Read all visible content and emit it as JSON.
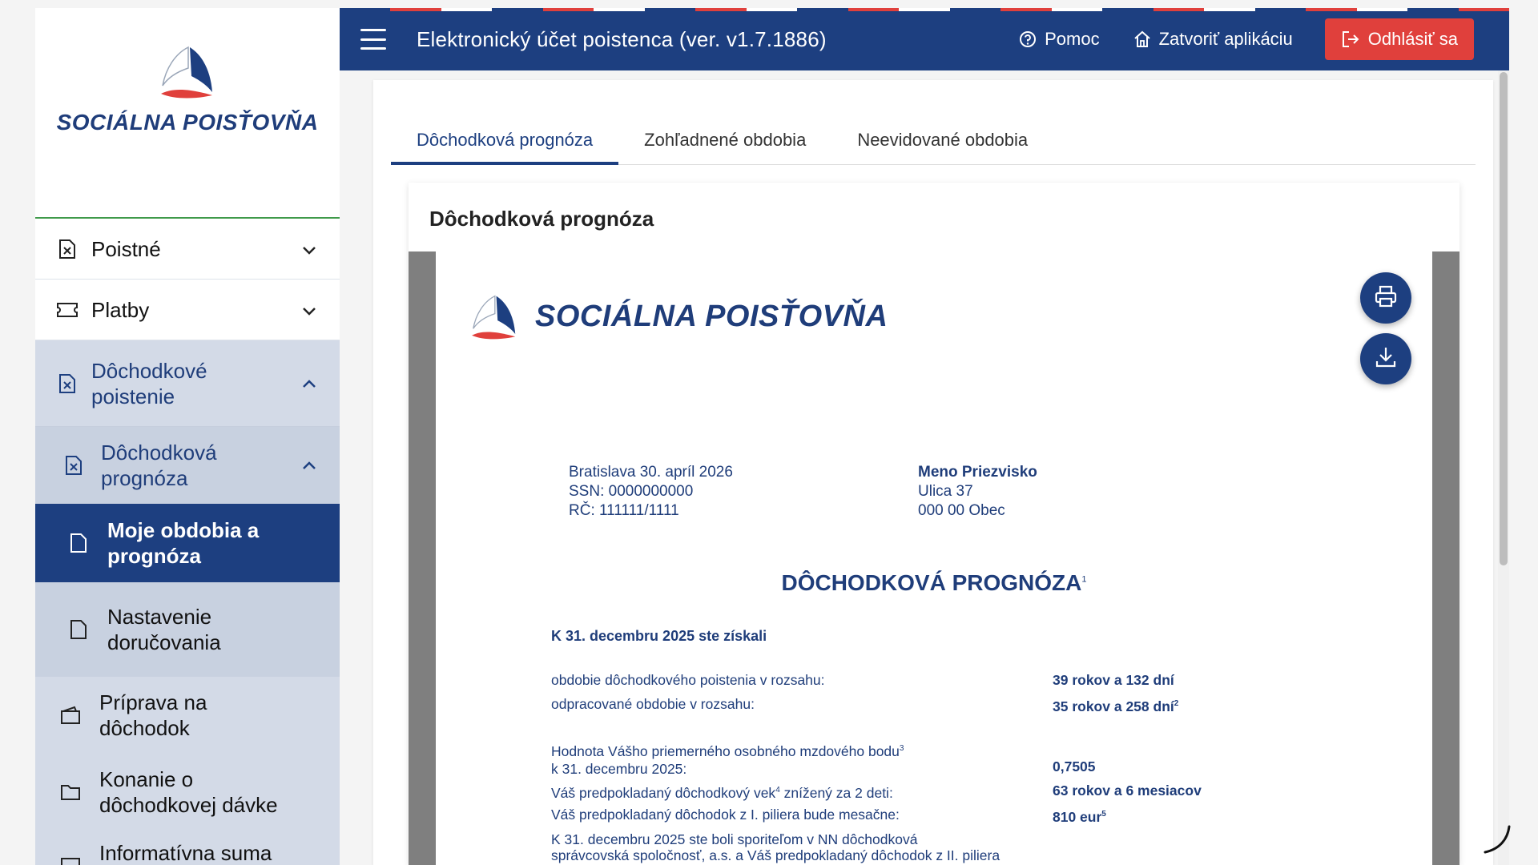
{
  "header": {
    "app_title": "Elektronický účet poistenca  (ver. v1.7.1886)",
    "help": "Pomoc",
    "close_app": "Zatvoriť aplikáciu",
    "logout": "Odhlásiť sa"
  },
  "sidebar": {
    "logo_text": "SOCIÁLNA POISŤOVŇA",
    "items": [
      {
        "label": "Poistné"
      },
      {
        "label": "Platby"
      },
      {
        "label": "Dôchodkové poistenie"
      },
      {
        "label": "Dôchodková prognóza"
      },
      {
        "label": "Moje obdobia a prognóza"
      },
      {
        "label": "Nastavenie doručovania"
      },
      {
        "label": "Príprava na dôchodok"
      },
      {
        "label": "Konanie o dôchodkovej dávke"
      },
      {
        "label": "Informatívna suma"
      }
    ]
  },
  "tabs": [
    {
      "label": "Dôchodková prognóza",
      "active": true
    },
    {
      "label": "Zohľadnené obdobia",
      "active": false
    },
    {
      "label": "Neevidované obdobia",
      "active": false
    }
  ],
  "card": {
    "title": "Dôchodková prognóza"
  },
  "document": {
    "logo_text": "SOCIÁLNA POISŤOVŇA",
    "place_date": "Bratislava 30. apríl 2026",
    "ssn": "SSN: 0000000000",
    "rc": "RČ: 111111/1111",
    "recipient_name": "Meno Priezvisko",
    "recipient_street": "Ulica 37",
    "recipient_city": "000 00 Obec",
    "heading": "DÔCHODKOVÁ PROGNÓZA",
    "heading_fn": "1",
    "subheading": "K 31. decembru 2025 ste získali",
    "rows": [
      {
        "key": "obdobie dôchodkového poistenia v rozsahu:",
        "value": "39 rokov a 132 dní"
      },
      {
        "key": "odpracované obdobie v rozsahu:",
        "value": "35 rokov a 258 dní",
        "value_fn": "2"
      },
      {
        "key": "Hodnota Vášho priemerného osobného mzdového bodu",
        "key_fn": "3",
        "key2": "k 31. decembru 2025:",
        "value": "0,7505"
      },
      {
        "key": "Váš predpokladaný dôchodkový vek",
        "key_fn": "4",
        "key_tail": " znížený za 2 deti:",
        "value": "63 rokov a 6 mesiacov"
      },
      {
        "key": "Váš predpokladaný dôchodok z I. piliera bude mesačne:",
        "value": "810 eur",
        "value_fn": "5"
      },
      {
        "key": "K 31. decembru 2025 ste boli sporiteľom v NN dôchodková",
        "key2": "správcovská spoločnosť, a.s. a Váš predpokladaný dôchodok z II. piliera"
      }
    ]
  },
  "colors": {
    "primary": "#1d3f80",
    "danger": "#e0403c",
    "sidebar_bg": "#d3dae7",
    "viewer_bg": "#7f7f7f"
  },
  "icons": [
    "menu-icon",
    "help-icon",
    "home-icon",
    "logout-icon",
    "document-icon",
    "ticket-icon",
    "chevron-down-icon",
    "chevron-up-icon",
    "wallet-icon",
    "folder-icon",
    "print-icon",
    "download-icon",
    "loading-spinner-icon"
  ]
}
